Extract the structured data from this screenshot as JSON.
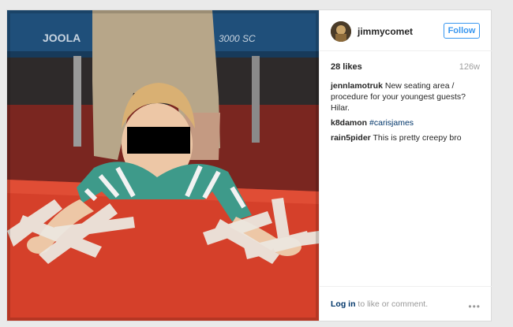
{
  "post": {
    "photo": {
      "description_icon": "photo-icon",
      "table_brand": "JOOLA",
      "table_model": "3000 SC"
    },
    "author": {
      "username": "jimmycomet",
      "avatar_icon": "user-avatar-icon"
    },
    "follow_label": "Follow",
    "likes_text": "28 likes",
    "age_text": "126w",
    "comments": [
      {
        "user": "jennlamotruk",
        "text": "New seating area / procedure for your youngest guests? Hilar."
      },
      {
        "user": "k8damon",
        "tag": "#carisjames"
      },
      {
        "user": "rain5pider",
        "text": "This is pretty creepy bro"
      }
    ],
    "footer": {
      "login_link": "Log in",
      "login_suffix": "to like or comment.",
      "more_icon": "more-options-icon",
      "more_glyph": "•••"
    }
  },
  "colors": {
    "accent": "#3897f0",
    "link": "#003569",
    "table_red": "#d5402a",
    "tape": "#ece7df"
  }
}
